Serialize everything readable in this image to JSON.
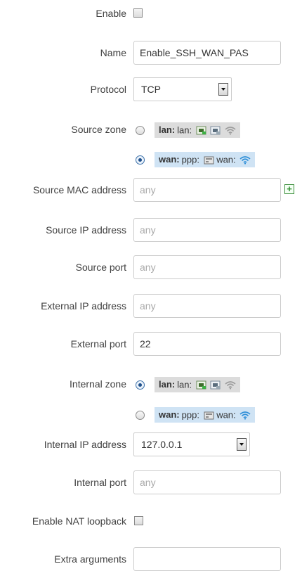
{
  "enable": {
    "label": "Enable",
    "checked": false
  },
  "name": {
    "label": "Name",
    "value": "Enable_SSH_WAN_PAS"
  },
  "protocol": {
    "label": "Protocol",
    "value": "TCP"
  },
  "source_zone": {
    "label": "Source zone",
    "options": [
      {
        "zone": "lan:",
        "iface_text": "lan:",
        "selected": false,
        "color": "#dcdcdc"
      },
      {
        "zone": "wan:",
        "iface_text": "ppp:",
        "iface2_text": "wan:",
        "selected": true,
        "color": "#cfe3f4"
      }
    ]
  },
  "source_mac": {
    "label": "Source MAC address",
    "placeholder": "any"
  },
  "source_ip": {
    "label": "Source IP address",
    "placeholder": "any"
  },
  "source_port": {
    "label": "Source port",
    "placeholder": "any"
  },
  "external_ip": {
    "label": "External IP address",
    "placeholder": "any"
  },
  "external_port": {
    "label": "External port",
    "value": "22"
  },
  "internal_zone": {
    "label": "Internal zone",
    "options": [
      {
        "zone": "lan:",
        "iface_text": "lan:",
        "selected": true
      },
      {
        "zone": "wan:",
        "iface_text": "ppp:",
        "iface2_text": "wan:",
        "selected": false
      }
    ]
  },
  "internal_ip": {
    "label": "Internal IP address",
    "value": "127.0.0.1"
  },
  "internal_port": {
    "label": "Internal port",
    "placeholder": "any"
  },
  "nat_loopback": {
    "label": "Enable NAT loopback",
    "checked": false
  },
  "extra_args": {
    "label": "Extra arguments",
    "value": ""
  }
}
